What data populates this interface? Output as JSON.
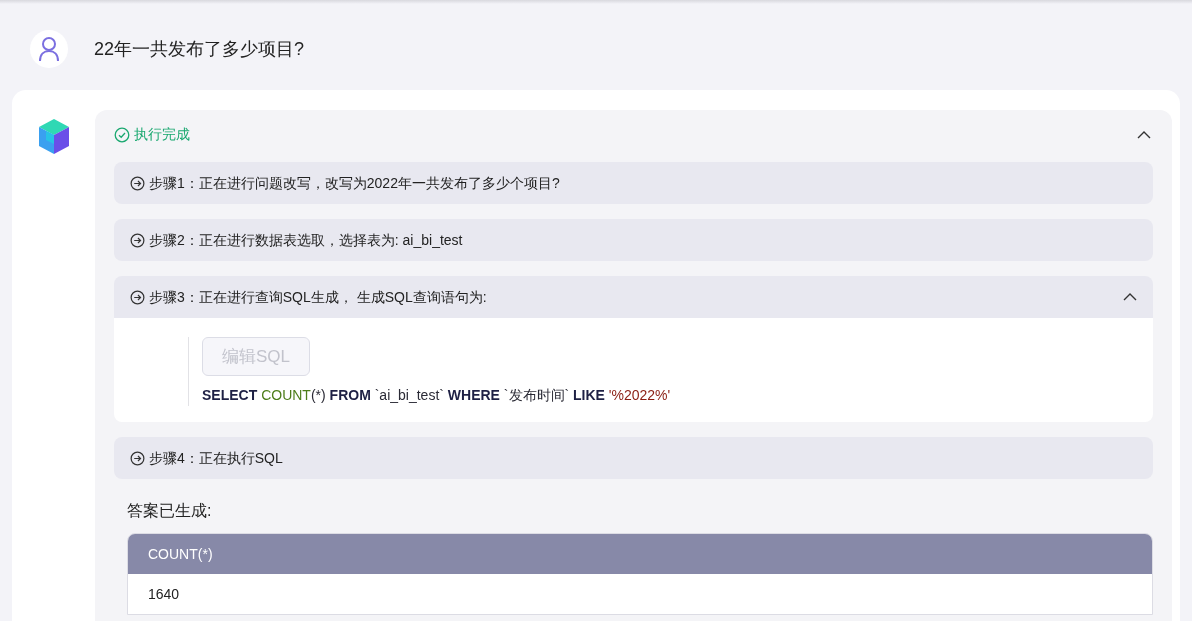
{
  "question": {
    "text": "22年一共发布了多少项目?"
  },
  "status": {
    "text": "执行完成",
    "done": true,
    "expanded": true
  },
  "steps": [
    {
      "text": "步骤1：正在进行问题改写，改写为2022年一共发布了多少个项目?",
      "expanded": false
    },
    {
      "text": "步骤2：正在进行数据表选取，选择表为: ai_bi_test",
      "expanded": false
    },
    {
      "text": "步骤3：正在进行查询SQL生成， 生成SQL查询语句为:",
      "expanded": true,
      "edit_button": {
        "label": "编辑SQL",
        "disabled": true
      },
      "sql": [
        {
          "kind": "keyword",
          "text": "SELECT "
        },
        {
          "kind": "function",
          "text": "COUNT"
        },
        {
          "kind": "plain",
          "text": "(*) "
        },
        {
          "kind": "keyword",
          "text": "FROM "
        },
        {
          "kind": "plain",
          "text": "`ai_bi_test` "
        },
        {
          "kind": "keyword",
          "text": "WHERE "
        },
        {
          "kind": "plain",
          "text": "`发布时间` "
        },
        {
          "kind": "keyword",
          "text": "LIKE "
        },
        {
          "kind": "string",
          "text": "'%2022%'"
        }
      ]
    },
    {
      "text": "步骤4：正在执行SQL",
      "expanded": false
    }
  ],
  "answer": {
    "label": "答案已生成:",
    "table": {
      "columns": [
        "COUNT(*)"
      ],
      "rows": [
        [
          "1640"
        ]
      ]
    }
  }
}
